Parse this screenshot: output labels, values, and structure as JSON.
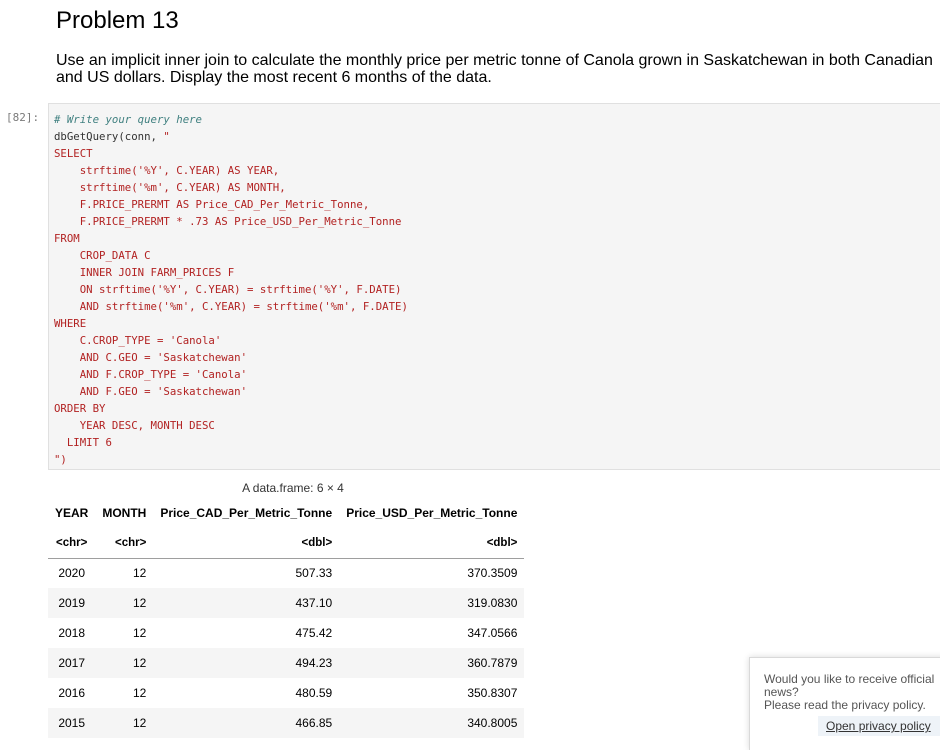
{
  "header": {
    "title": "Problem 13",
    "description": "Use an implicit inner join to calculate the monthly price per metric tonne of Canola grown in Saskatchewan in both Canadian and US dollars. Display the most recent 6 months of the data."
  },
  "cell": {
    "prompt": "[82]:",
    "code": {
      "comment": "# Write your query here",
      "call": "dbGetQuery(conn, ",
      "sql": "\"\nSELECT\n    strftime('%Y', C.YEAR) AS YEAR,\n    strftime('%m', C.YEAR) AS MONTH,\n    F.PRICE_PRERMT AS Price_CAD_Per_Metric_Tonne,\n    F.PRICE_PRERMT * .73 AS Price_USD_Per_Metric_Tonne\nFROM\n    CROP_DATA C\n    INNER JOIN FARM_PRICES F\n    ON strftime('%Y', C.YEAR) = strftime('%Y', F.DATE)\n    AND strftime('%m', C.YEAR) = strftime('%m', F.DATE)\nWHERE\n    C.CROP_TYPE = 'Canola'\n    AND C.GEO = 'Saskatchewan'\n    AND F.CROP_TYPE = 'Canola'\n    AND F.GEO = 'Saskatchewan'\nORDER BY\n    YEAR DESC, MONTH DESC\n  LIMIT 6\n\")"
    }
  },
  "output": {
    "caption": "A data.frame: 6 × 4",
    "columns": [
      "YEAR",
      "MONTH",
      "Price_CAD_Per_Metric_Tonne",
      "Price_USD_Per_Metric_Tonne"
    ],
    "types": [
      "<chr>",
      "<chr>",
      "<dbl>",
      "<dbl>"
    ],
    "rows": [
      [
        "2020",
        "12",
        "507.33",
        "370.3509"
      ],
      [
        "2019",
        "12",
        "437.10",
        "319.0830"
      ],
      [
        "2018",
        "12",
        "475.42",
        "347.0566"
      ],
      [
        "2017",
        "12",
        "494.23",
        "360.7879"
      ],
      [
        "2016",
        "12",
        "480.59",
        "350.8307"
      ],
      [
        "2015",
        "12",
        "466.85",
        "340.8005"
      ]
    ]
  },
  "cookie_banner": {
    "question": "Would you like to receive official news?",
    "privacy_text": "Please read the privacy policy.",
    "privacy_link": "Open privacy policy"
  }
}
